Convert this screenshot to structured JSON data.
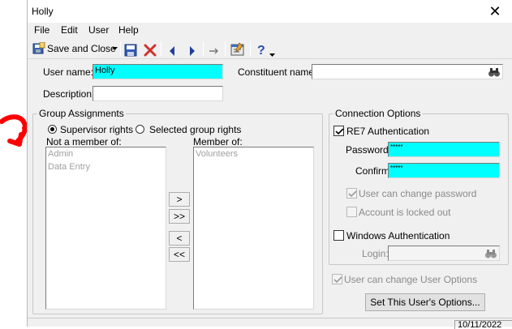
{
  "window": {
    "title": "Holly",
    "close_symbol": "✕"
  },
  "menu": [
    "File",
    "Edit",
    "User",
    "Help"
  ],
  "toolbar": {
    "save_and_close": "Save and Close",
    "icons": [
      "save-and-close-icon",
      "dropdown-arrow-icon",
      "save-disk-icon",
      "delete-x-icon",
      "previous-arrow-icon",
      "next-arrow-icon",
      "goto-arrow-icon",
      "properties-icon",
      "help-icon",
      "help-dropdown-icon"
    ]
  },
  "fields": {
    "user_name_label": "User name:",
    "user_name_value": "Holly",
    "constituent_label": "Constituent name:",
    "constituent_value": "",
    "description_label": "Description:",
    "description_value": ""
  },
  "group_assignments": {
    "title": "Group Assignments",
    "supervisor_rights": "Supervisor rights",
    "selected_group_rights": "Selected group rights",
    "selected_option": "Supervisor rights",
    "not_member_label": "Not a member of:",
    "member_label": "Member of:",
    "not_member_items": [
      "Admin",
      "Data Entry"
    ],
    "member_items": [
      "Volunteers"
    ],
    "buttons": [
      ">",
      ">>",
      "<",
      "<<"
    ]
  },
  "connection_options": {
    "title": "Connection Options",
    "re7_auth_label": "RE7 Authentication",
    "re7_auth_checked": true,
    "password_label": "Password:",
    "password_value": "*****",
    "confirm_label": "Confirm:",
    "confirm_value": "*****",
    "user_can_change_password": "User can change password",
    "user_can_change_password_checked": true,
    "account_locked_out": "Account is locked out",
    "account_locked_out_checked": false,
    "windows_auth_label": "Windows Authentication",
    "windows_auth_checked": false,
    "login_label": "Login:",
    "login_value": ""
  },
  "user_options": {
    "change_options_label": "User can change User Options",
    "change_options_checked": true,
    "set_options_button": "Set This User's Options..."
  },
  "status": {
    "date": "10/11/2022"
  },
  "colors": {
    "highlight_field": "#00ffff",
    "annotation_red": "#ff0000"
  }
}
